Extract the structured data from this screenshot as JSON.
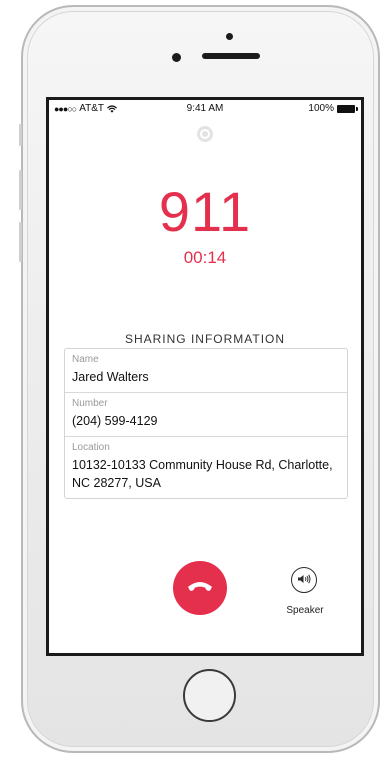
{
  "status_bar": {
    "signal": "●●●○○",
    "carrier": "AT&T",
    "time": "9:41 AM",
    "battery": "100%"
  },
  "call": {
    "number": "911",
    "duration": "00:14"
  },
  "sharing": {
    "title": "SHARING INFORMATION",
    "fields": [
      {
        "label": "Name",
        "value": "Jared Walters"
      },
      {
        "label": "Number",
        "value": "(204) 599-4129"
      },
      {
        "label": "Location",
        "value": "10132-10133 Community House Rd, Charlotte, NC 28277, USA"
      }
    ]
  },
  "controls": {
    "speaker_label": "Speaker"
  },
  "colors": {
    "accent": "#e4304d"
  },
  "icons": {
    "end_call": "phone-hangup-icon",
    "speaker": "speaker-icon",
    "app_logo": "app-logo-icon",
    "wifi": "wifi-icon",
    "battery": "battery-icon"
  }
}
